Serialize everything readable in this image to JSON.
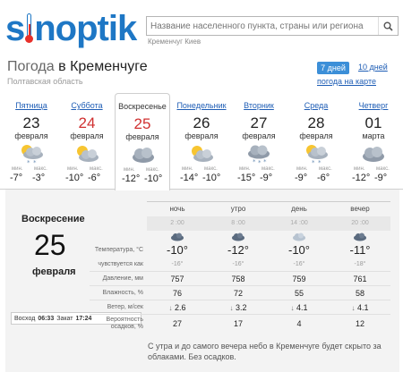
{
  "logo": {
    "text_pre": "s",
    "text_post": "noptik"
  },
  "search": {
    "placeholder": "Название населенного пункта, страны или региона",
    "recent": "Кременчуг Киев"
  },
  "title": {
    "prefix": "Погода",
    "city": "в Кременчуге",
    "region": "Полтавская область"
  },
  "tabs": {
    "seven": "7 дней",
    "ten": "10 дней",
    "map": "погода на карте"
  },
  "labels": {
    "min": "мин.",
    "max": "макс."
  },
  "days": [
    {
      "name": "Пятница",
      "date": "23",
      "month": "февраля",
      "min": "-7°",
      "max": "-3°",
      "weekend": false,
      "icon": "cloud-snow-sun-icon"
    },
    {
      "name": "Суббота",
      "date": "24",
      "month": "февраля",
      "min": "-10°",
      "max": "-6°",
      "weekend": true,
      "icon": "cloud-sun-icon"
    },
    {
      "name": "Воскресенье",
      "date": "25",
      "month": "февраля",
      "min": "-12°",
      "max": "-10°",
      "weekend": true,
      "icon": "cloud-icon"
    },
    {
      "name": "Понедельник",
      "date": "26",
      "month": "февраля",
      "min": "-14°",
      "max": "-10°",
      "weekend": false,
      "icon": "cloud-sun-icon"
    },
    {
      "name": "Вторник",
      "date": "27",
      "month": "февраля",
      "min": "-15°",
      "max": "-9°",
      "weekend": false,
      "icon": "cloud-snow-icon"
    },
    {
      "name": "Среда",
      "date": "28",
      "month": "февраля",
      "min": "-9°",
      "max": "-6°",
      "weekend": false,
      "icon": "cloud-snow-sun-icon"
    },
    {
      "name": "Четверг",
      "date": "01",
      "month": "марта",
      "min": "-12°",
      "max": "-9°",
      "weekend": false,
      "icon": "cloud-icon"
    }
  ],
  "detail": {
    "day_name": "Воскресение",
    "date": "25",
    "month": "февраля",
    "sunrise_label": "Восход",
    "sunrise": "06:33",
    "sunset_label": "Закат",
    "sunset": "17:24",
    "periods": [
      "ночь",
      "утро",
      "день",
      "вечер"
    ],
    "times": [
      "2 :00",
      "8 :00",
      "14 :00",
      "20 :00"
    ],
    "rows": {
      "temp": {
        "label": "Температура, °C",
        "values": [
          "-10°",
          "-12°",
          "-10°",
          "-11°"
        ]
      },
      "feels": {
        "label": "чувствуется как",
        "values": [
          "-16°",
          "-16°",
          "-16°",
          "-18°"
        ]
      },
      "pressure": {
        "label": "Давление, мм",
        "values": [
          "757",
          "758",
          "759",
          "761"
        ]
      },
      "humidity": {
        "label": "Влажность, %",
        "values": [
          "76",
          "72",
          "55",
          "58"
        ]
      },
      "wind": {
        "label": "Ветер, м/сек",
        "values": [
          "2.6",
          "3.2",
          "4.1",
          "4.1"
        ]
      },
      "precip": {
        "label": "Вероятность осадков, %",
        "values": [
          "27",
          "17",
          "4",
          "12"
        ]
      }
    },
    "note": "С утра и до самого вечера небо в Кременчуге будет скрыто за облаками. Без осадков."
  },
  "colors": {
    "brand": "#1e77c5",
    "accent_red": "#d03030",
    "tab_active": "#3c8fd8"
  }
}
